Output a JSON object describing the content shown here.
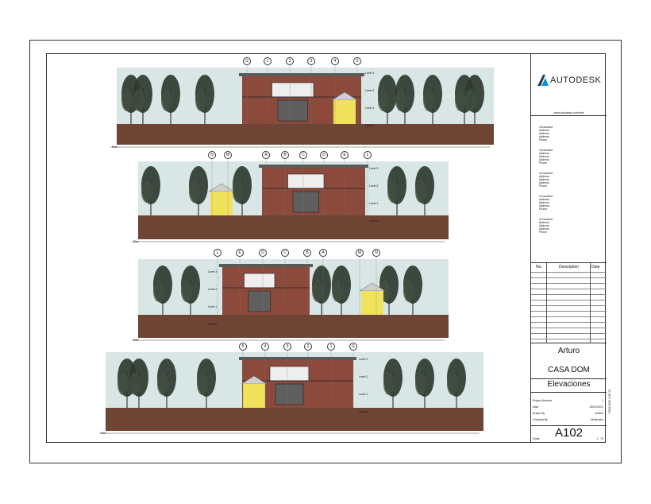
{
  "brand": {
    "name": "AUTODESK",
    "url": "www.autodesk.com/revit"
  },
  "consultants": [
    {
      "lines": [
        "Consultant",
        "Address",
        "Address",
        "Address",
        "Phone"
      ]
    },
    {
      "lines": [
        "Consultant",
        "Address",
        "Address",
        "Address",
        "Phone"
      ]
    },
    {
      "lines": [
        "Consultant",
        "Address",
        "Address",
        "Address",
        "Phone"
      ]
    },
    {
      "lines": [
        "Consultant",
        "Address",
        "Address",
        "Address",
        "Phone"
      ]
    },
    {
      "lines": [
        "Consultant",
        "Address",
        "Address",
        "Address",
        "Phone"
      ]
    }
  ],
  "revision_table": {
    "headers": [
      "No.",
      "Description",
      "Date"
    ]
  },
  "project": {
    "owner": "Arturo",
    "name": "CASA DOM",
    "sheet_name": "Elevaciones",
    "project_number_label": "Project Number",
    "project_number_value": "1",
    "date_label": "Date",
    "date_value": "23/01/2021",
    "drawn_label": "Drawn By",
    "drawn_value": "Author",
    "checked_label": "Checked By",
    "checked_value": "Verificador",
    "sheet_number": "A102",
    "scale_label": "Scale",
    "scale_value": "1 : 75",
    "side_stamp": "23/01/2021 5:49:19"
  },
  "elevations": [
    {
      "grid_tags": [
        "G",
        "1",
        "2",
        "3",
        "4",
        "5"
      ]
    },
    {
      "grid_tags": [
        "N",
        "M",
        "A",
        "B",
        "C",
        "D",
        "E",
        "L"
      ]
    },
    {
      "grid_tags": [
        "L",
        "E",
        "D",
        "C",
        "B",
        "A",
        "M",
        "N"
      ]
    },
    {
      "grid_tags": [
        "5",
        "4",
        "3",
        "2",
        "1",
        "G"
      ]
    }
  ],
  "level_marks": [
    "Level 3",
    "Level 2",
    "Level 1",
    "Level 0"
  ],
  "elevation_tag": "Elev"
}
